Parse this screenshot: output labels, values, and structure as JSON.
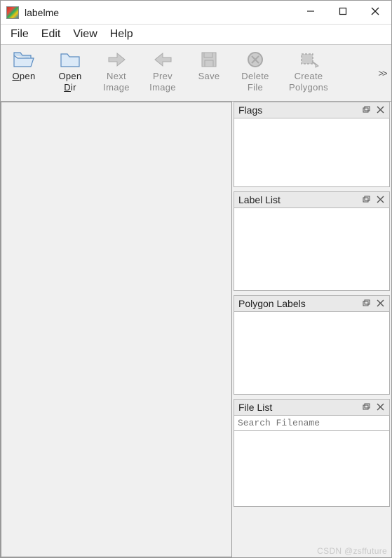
{
  "window": {
    "title": "labelme"
  },
  "menu": {
    "file": "File",
    "edit": "Edit",
    "view": "View",
    "help": "Help"
  },
  "toolbar": {
    "open": {
      "label_pre": "",
      "label_u": "O",
      "label_post": "pen",
      "label2": ""
    },
    "open_dir": {
      "label_pre": "Open",
      "label_u": "",
      "label_post": "",
      "label2_pre": "",
      "label2_u": "D",
      "label2_post": "ir"
    },
    "next_image": {
      "label_pre": "",
      "label_u": "N",
      "label_post": "ext",
      "label2": "Image"
    },
    "prev_image": {
      "label_pre": "",
      "label_u": "P",
      "label_post": "rev",
      "label2": "Image"
    },
    "save": {
      "label_pre": "",
      "label_u": "S",
      "label_post": "ave",
      "label2": ""
    },
    "delete_file": {
      "label_pre": "",
      "label_u": "D",
      "label_post": "elete",
      "label2": "File"
    },
    "create_polygons": {
      "label_pre": "Create",
      "label_u": "",
      "label_post": "",
      "label2": "Polygons"
    },
    "overflow": ">>"
  },
  "panels": {
    "flags": "Flags",
    "label_list": "Label List",
    "polygon_labels": "Polygon Labels",
    "file_list": "File List",
    "search_placeholder": "Search Filename"
  },
  "watermark": "CSDN @zsffuture"
}
